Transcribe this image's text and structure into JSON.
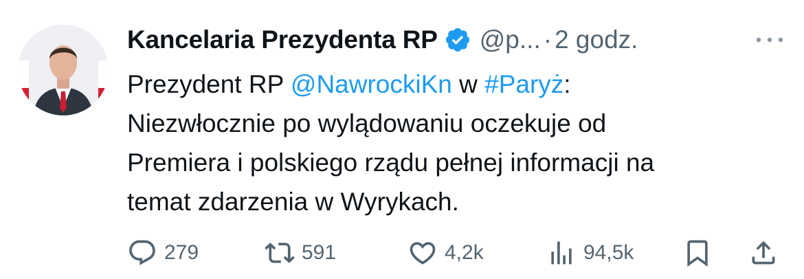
{
  "account": {
    "name": "Kancelaria Prezydenta RP",
    "handle": "@p...",
    "separator": "·",
    "time": "2 godz.",
    "verified": true
  },
  "tweet": {
    "lines": [
      [
        "Prezydent RP ",
        "@NawrockiKn",
        " w ",
        "#Paryż",
        ":"
      ],
      "Niezwłocznie po wylądowaniu oczekuje od",
      "Premiera i polskiego rządu pełnej informacji na",
      "temat zdarzenia w Wyrykach."
    ]
  },
  "actions": {
    "replies": "279",
    "reposts": "591",
    "likes": "4,2k",
    "views": "94,5k"
  },
  "icons": {
    "avatar": "avatar-photo",
    "verified": "verified-badge-icon",
    "more": "more-icon",
    "reply": "reply-icon",
    "repost": "repost-icon",
    "like": "heart-icon",
    "views": "views-icon",
    "bookmark": "bookmark-icon",
    "share": "share-icon"
  },
  "colors": {
    "text": "#0f1419",
    "secondary": "#536471",
    "link": "#1d9bf0",
    "background": "#ffffff"
  }
}
